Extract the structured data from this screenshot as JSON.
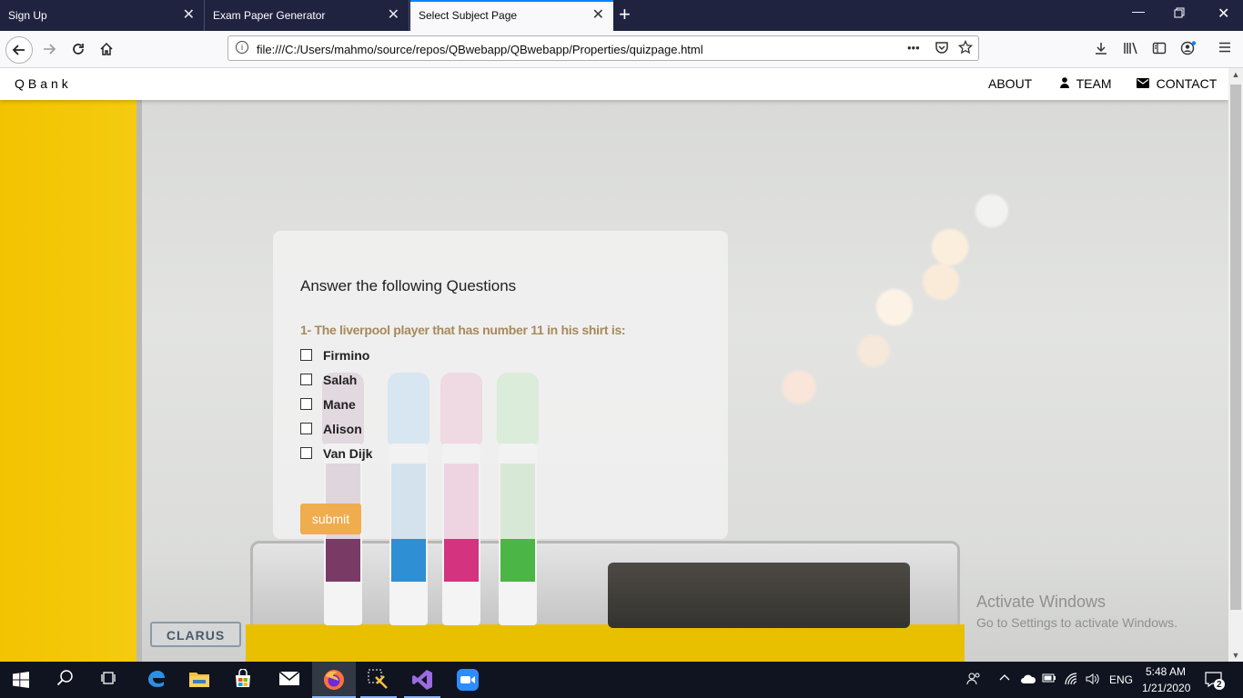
{
  "browser": {
    "tabs": [
      {
        "title": "Sign Up",
        "active": false
      },
      {
        "title": "Exam Paper Generator",
        "active": false
      },
      {
        "title": "Select Subject Page",
        "active": true
      }
    ],
    "close_glyph": "✕",
    "new_tab_glyph": "+",
    "url": "file:///C:/Users/mahmo/source/repos/QBwebapp/QBwebapp/Properties/quizpage.html",
    "page_actions_glyph": "•••"
  },
  "site": {
    "brand": "QBank",
    "menu": [
      {
        "label": "ABOUT",
        "icon": ""
      },
      {
        "label": "TEAM",
        "icon": "user-icon"
      },
      {
        "label": "CONTACT",
        "icon": "envelope-icon"
      }
    ]
  },
  "quiz": {
    "heading": "Answer the following Questions",
    "question": "1- The liverpool player that has number 11 in his shirt is:",
    "options": [
      "Firmino",
      "Salah",
      "Mane",
      "Alison",
      "Van Dijk"
    ],
    "submit_label": "submit"
  },
  "background": {
    "logo_text": "CLARUS"
  },
  "watermark": {
    "title": "Activate Windows",
    "subtitle": "Go to Settings to activate Windows."
  },
  "taskbar": {
    "language": "ENG",
    "time": "5:48 AM",
    "date": "1/21/2020",
    "notification_count": "2"
  },
  "colors": {
    "tab_bar": "#202340",
    "accent_tab": "#0a84ff",
    "question_text": "#a68a5c",
    "submit_button": "#f0ad4e",
    "wall_yellow": "#f2c300"
  }
}
